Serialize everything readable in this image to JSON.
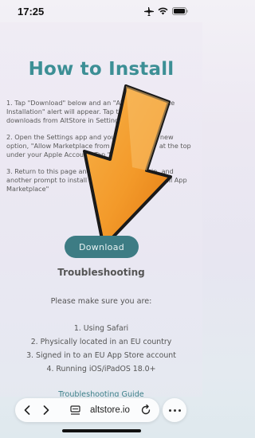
{
  "status_bar": {
    "time": "17:25"
  },
  "page": {
    "title": "How to Install",
    "steps": [
      "1. Tap \"Download\" below and an \"Allow Marketplace Installation\" alert will appear. Tap the link to allow downloads from AltStore in Settings.",
      "2. Open the Settings app and you should see a new option, \"Allow Marketplace from \"AltStore LLC\" at the top under your Apple Account. Tap \"Allow\"",
      "3. Return to this page and tap Download again, and another prompt to install will appear. Select \"Install App Marketplace\""
    ],
    "download_label": "Download",
    "troubleshooting_heading": "Troubleshooting",
    "please_text": "Please make sure you are:",
    "requirements": [
      "1. Using Safari",
      "2. Physically located in an EU country",
      "3. Signed in to an EU App Store account",
      "4. Running iOS/iPadOS 18.0+"
    ],
    "guide_link": "Troubleshooting Guide"
  },
  "browser": {
    "url": "altstore.io"
  },
  "colors": {
    "accent": "#3c8f95",
    "button": "#3d7c84",
    "arrow_orange": "#f39a2a"
  }
}
